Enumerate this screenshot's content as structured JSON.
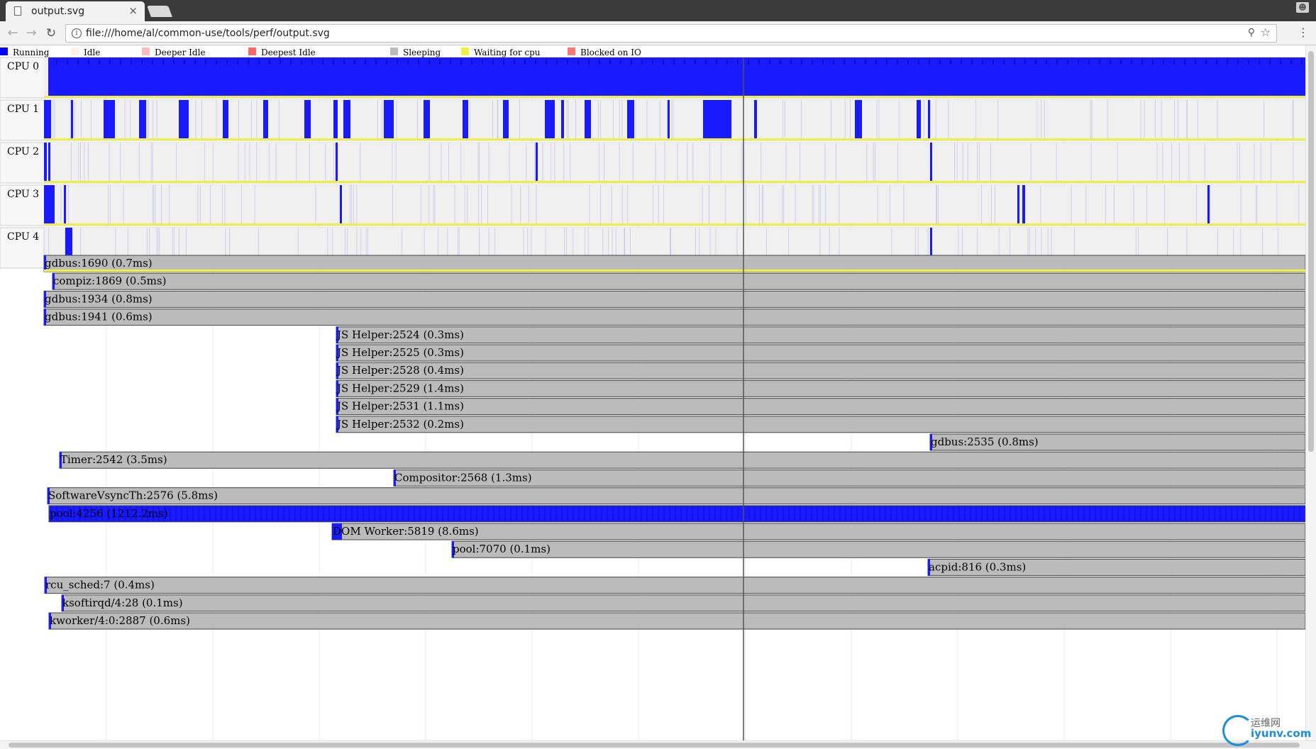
{
  "browser": {
    "tab_title": "output.svg",
    "tab_close": "×",
    "url": "file:///home/al/common-use/tools/perf/output.svg",
    "back_icon": "arrow-left-icon",
    "forward_icon": "arrow-right-icon",
    "reload_icon": "reload-icon",
    "info_icon": "info-icon",
    "zoom_icon": "magnifier-icon",
    "star_icon": "star-icon",
    "menu_icon": "kebab-menu-icon"
  },
  "legend": [
    {
      "label": "Running",
      "color": "#0000ff"
    },
    {
      "label": "Idle",
      "color": "#ffeeee"
    },
    {
      "label": "Deeper Idle",
      "color": "#ffbbbb"
    },
    {
      "label": "Deepest Idle",
      "color": "#ff6666"
    },
    {
      "label": "Sleeping",
      "color": "#bbbbbb"
    },
    {
      "label": "Waiting for cpu",
      "color": "#eeee44"
    },
    {
      "label": "Blocked on IO",
      "color": "#ff7777"
    }
  ],
  "colors": {
    "running": "#1a1aff",
    "idle_background": "#f0f0f0",
    "sleeping": "#bbbbbb",
    "waiting": "#eeee44",
    "cursor_line": "#555555"
  },
  "cpus": [
    {
      "label": "CPU 0"
    },
    {
      "label": "CPU 1"
    },
    {
      "label": "CPU 2"
    },
    {
      "label": "CPU 3"
    },
    {
      "label": "CPU 4"
    }
  ],
  "tasks": [
    {
      "label": "gdbus:1690 (0.7ms)",
      "running": false
    },
    {
      "label": "compiz:1869 (0.5ms)",
      "running": false
    },
    {
      "label": "gdbus:1934 (0.8ms)",
      "running": false
    },
    {
      "label": "gdbus:1941 (0.6ms)",
      "running": false
    },
    {
      "label": "JS Helper:2524 (0.3ms)",
      "running": false
    },
    {
      "label": "JS Helper:2525 (0.3ms)",
      "running": false
    },
    {
      "label": "JS Helper:2528 (0.4ms)",
      "running": false
    },
    {
      "label": "JS Helper:2529 (1.4ms)",
      "running": false
    },
    {
      "label": "JS Helper:2531 (1.1ms)",
      "running": false
    },
    {
      "label": "JS Helper:2532 (0.2ms)",
      "running": false
    },
    {
      "label": "gdbus:2535 (0.8ms)",
      "running": false
    },
    {
      "label": "Timer:2542 (3.5ms)",
      "running": false
    },
    {
      "label": "Compositor:2568 (1.3ms)",
      "running": false
    },
    {
      "label": "SoftwareVsyncTh:2576 (5.8ms)",
      "running": false
    },
    {
      "label": "pool:4256 (1212.2ms)",
      "running": true
    },
    {
      "label": "DOM Worker:5819 (8.6ms)",
      "running": false
    },
    {
      "label": "pool:7070 (0.1ms)",
      "running": false
    },
    {
      "label": "acpid:816 (0.3ms)",
      "running": false
    },
    {
      "label": "rcu_sched:7 (0.4ms)",
      "running": false
    },
    {
      "label": "ksoftirqd/4:28 (0.1ms)",
      "running": false
    },
    {
      "label": "kworker/4:0:2887 (0.6ms)",
      "running": false
    }
  ],
  "watermark": {
    "chinese": "运维网",
    "site": "iyunv.com"
  }
}
